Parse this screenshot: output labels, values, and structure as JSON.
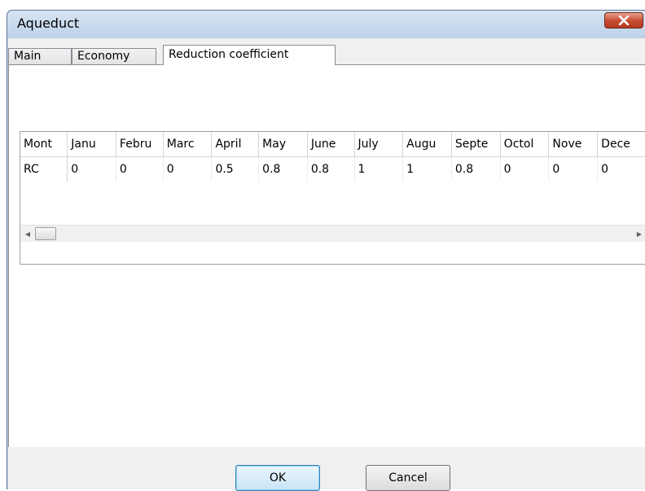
{
  "window": {
    "title": "Aqueduct",
    "close_glyph": "✕"
  },
  "tabs": [
    {
      "label": "Main"
    },
    {
      "label": "Economy"
    },
    {
      "label": "Reduction coefficient"
    }
  ],
  "table": {
    "headers": [
      "Mont",
      "Janu",
      "Febru",
      "Marc",
      "April",
      "May",
      "June",
      "July",
      "Augu",
      "Septe",
      "Octol",
      "Nove",
      "Dece"
    ],
    "rows": [
      {
        "cells": [
          "RC",
          "0",
          "0",
          "0",
          "0.5",
          "0.8",
          "0.8",
          "1",
          "1",
          "0.8",
          "0",
          "0",
          "0"
        ]
      }
    ]
  },
  "scrollbar": {
    "left_arrow": "◀",
    "right_arrow": "▶"
  },
  "buttons": {
    "ok": "OK",
    "cancel": "Cancel"
  },
  "colors": {
    "title_bg": "#c2d5ea",
    "close_red": "#c74a2f",
    "default_button_border": "#3c7fb1"
  }
}
